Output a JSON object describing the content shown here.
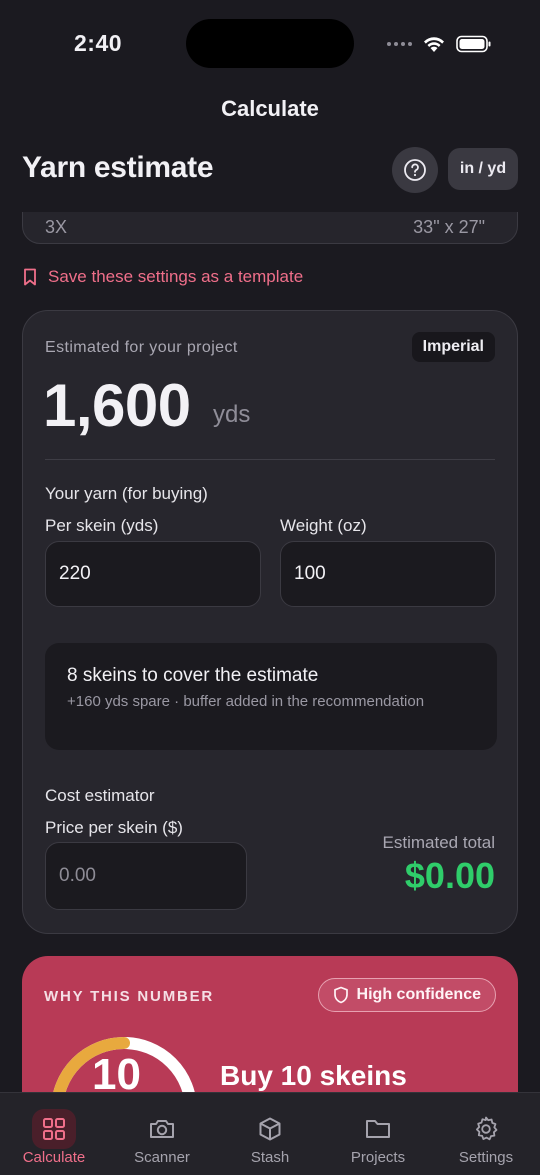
{
  "status_bar": {
    "time": "2:40"
  },
  "nav": {
    "title": "Calculate"
  },
  "header": {
    "title": "Yarn estimate",
    "unit_toggle": "in / yd"
  },
  "previous_card": {
    "size_label": "3X",
    "dimensions": "33\" x 27\""
  },
  "template_link": {
    "label": "Save these settings as a template"
  },
  "estimate": {
    "label": "Estimated for your project",
    "system_badge": "Imperial",
    "value": "1,600",
    "unit": "yds",
    "yarn_section_title": "Your yarn (for buying)",
    "per_skein_label": "Per skein (yds)",
    "per_skein_value": "220",
    "weight_label": "Weight (oz)",
    "weight_value": "100",
    "skeins_title": "8 skeins to cover the estimate",
    "skeins_subtitle": "+160 yds spare · buffer added in the recommendation",
    "cost_title": "Cost estimator",
    "price_label": "Price per skein ($)",
    "price_placeholder": "0.00",
    "total_label": "Estimated total",
    "total_value": "$0.00"
  },
  "why": {
    "title": "WHY THIS NUMBER",
    "confidence": "High confidence",
    "gauge_number": "10",
    "buy_text": "Buy 10 skeins"
  },
  "tabs": [
    {
      "label": "Calculate",
      "icon": "grid-icon",
      "active": true
    },
    {
      "label": "Scanner",
      "icon": "camera-icon",
      "active": false
    },
    {
      "label": "Stash",
      "icon": "box-icon",
      "active": false
    },
    {
      "label": "Projects",
      "icon": "folder-icon",
      "active": false
    },
    {
      "label": "Settings",
      "icon": "gear-icon",
      "active": false
    }
  ],
  "colors": {
    "accent": "#f06f8a",
    "success": "#2fcd6a",
    "why_card": "#b83a56",
    "gauge": "#e8a93e"
  }
}
